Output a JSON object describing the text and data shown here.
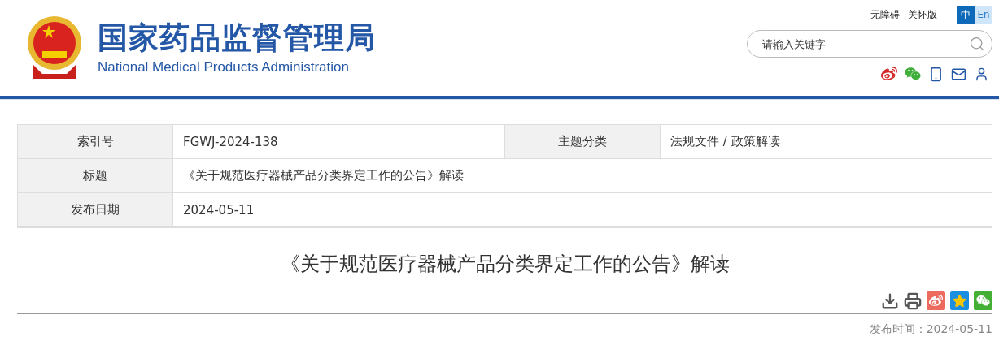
{
  "header": {
    "title_cn": "国家药品监督管理局",
    "title_en": "National Medical Products Administration",
    "top_links": [
      "无障碍",
      "关怀版"
    ],
    "languages": [
      {
        "label": "中",
        "selected": true
      },
      {
        "label": "En",
        "selected": false
      }
    ],
    "search": {
      "placeholder": "请输入关键字"
    }
  },
  "info_table": {
    "rows": [
      {
        "cells": [
          {
            "label": "索引号",
            "value": "FGWJ-2024-138"
          },
          {
            "label": "主题分类",
            "value": "法规文件 / 政策解读"
          }
        ]
      },
      {
        "cells": [
          {
            "label": "标题",
            "value": "《关于规范医疗器械产品分类界定工作的公告》解读"
          }
        ]
      },
      {
        "cells": [
          {
            "label": "发布日期",
            "value": "2024-05-11"
          }
        ]
      }
    ]
  },
  "article": {
    "title": "《关于规范医疗器械产品分类界定工作的公告》解读",
    "publish_date": "发布时间：2024-05-11"
  }
}
